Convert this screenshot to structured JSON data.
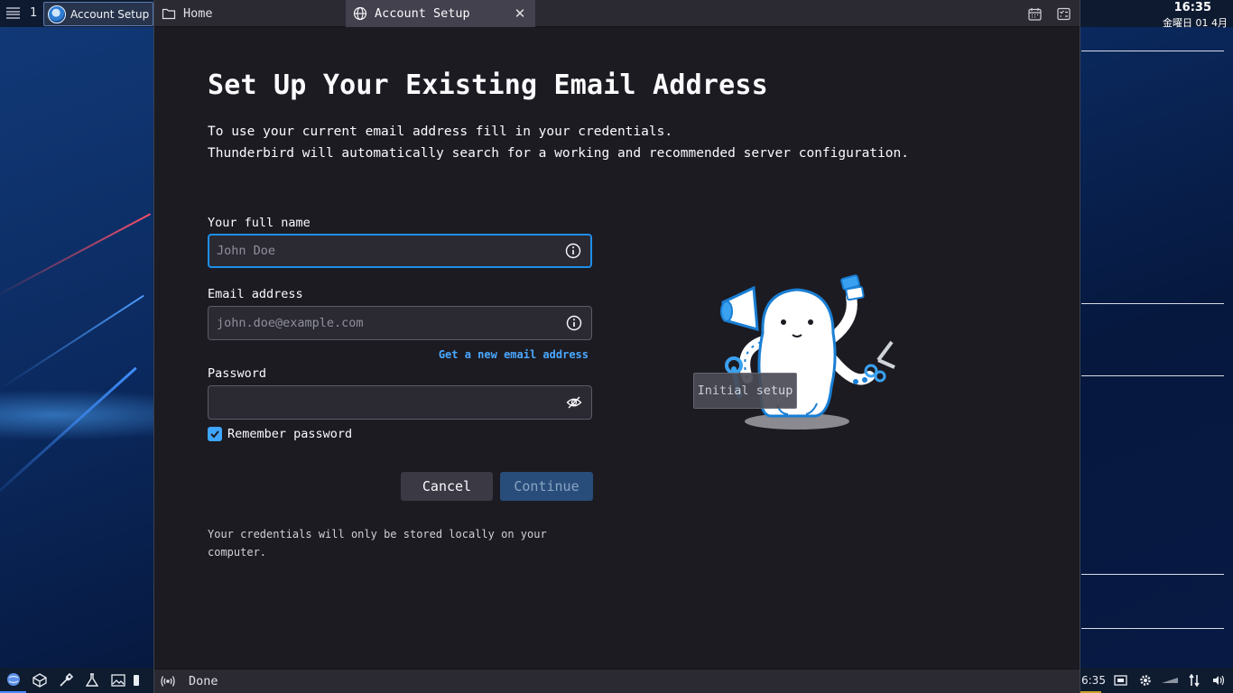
{
  "desktop": {
    "workspace": "1",
    "task_label": "Account Setup - M",
    "clock_time": "16:35",
    "clock_date": "金曜日 01 4月",
    "tray_time": "6:35"
  },
  "tabs": [
    {
      "label": "Home",
      "icon": "folder-icon"
    },
    {
      "label": "Account Setup",
      "icon": "globe-icon"
    }
  ],
  "page": {
    "title": "Set Up Your Existing Email Address",
    "intro_line1": "To use your current email address fill in your credentials.",
    "intro_line2": "Thunderbird will automatically search for a working and recommended server configuration."
  },
  "form": {
    "full_name_label": "Your full name",
    "full_name_placeholder": "John Doe",
    "full_name_value": "",
    "email_label": "Email address",
    "email_placeholder": "john.doe@example.com",
    "email_value": "",
    "password_label": "Password",
    "password_value": "",
    "new_email_link": "Get a new email address",
    "remember_label": "Remember password",
    "remember_checked": true,
    "cancel_label": "Cancel",
    "continue_label": "Continue",
    "footnote": "Your credentials will only be stored locally on your computer."
  },
  "illustration_tooltip": "Initial setup",
  "status": {
    "text": "Done"
  },
  "colors": {
    "accent": "#1e8fe8",
    "link": "#4aa8ff",
    "background": "#1c1b22"
  }
}
